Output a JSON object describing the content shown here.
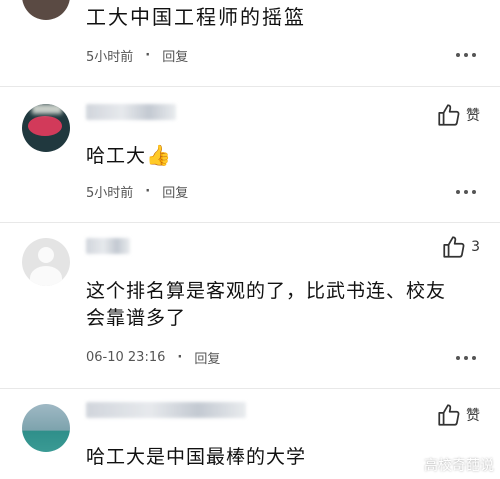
{
  "comments": [
    {
      "text": "工大中国工程师的摇篮",
      "time": "5小时前",
      "reply": "回复"
    },
    {
      "text": "哈工大",
      "emoji": "👍",
      "time": "5小时前",
      "reply": "回复",
      "like_label": "赞"
    },
    {
      "text_line1": "这个排名算是客观的了，比武书连、校友",
      "text_line2": "会靠谱多了",
      "time": "06-10 23:16",
      "reply": "回复",
      "like_count": "3"
    },
    {
      "text": "哈工大是中国最棒的大学",
      "like_label": "赞"
    }
  ],
  "separator": "·",
  "watermark": "高校奇葩说",
  "icons": [
    "thumbs-up-icon",
    "more-dots-icon"
  ]
}
